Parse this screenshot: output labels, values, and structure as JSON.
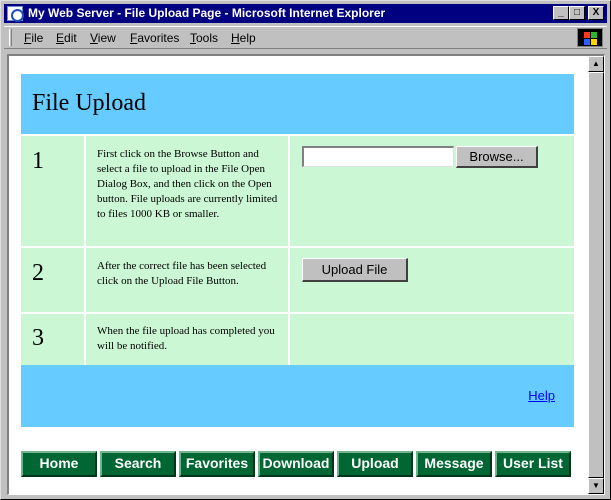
{
  "window": {
    "title": "My Web Server - File Upload Page - Microsoft Internet Explorer",
    "controls": {
      "minimize": "_",
      "maximize": "□",
      "close": "X"
    }
  },
  "menubar": {
    "items": [
      "File",
      "Edit",
      "View",
      "Favorites",
      "Tools",
      "Help"
    ]
  },
  "page": {
    "title": "File Upload",
    "steps": [
      {
        "number": "1",
        "text": "First click on the Browse Button and select a file to upload in the File Open Dialog Box, and then click on the Open button. File uploads are currently limited to files   1000 KB or smaller."
      },
      {
        "number": "2",
        "text": "After the correct file has been selected click on the Upload File Button."
      },
      {
        "number": "3",
        "text": "When the file upload has completed you will be notified."
      }
    ],
    "file_input_value": "",
    "browse_label": "Browse...",
    "upload_label": "Upload File",
    "help_link": "Help",
    "nav": [
      "Home",
      "Search",
      "Favorites",
      "Download",
      "Upload",
      "Message",
      "User List"
    ]
  },
  "colors": {
    "header_bg": "#66ccff",
    "row_bg": "#ccf7d4",
    "nav_bg": "#006633",
    "titlebar_bg": "#000080"
  }
}
